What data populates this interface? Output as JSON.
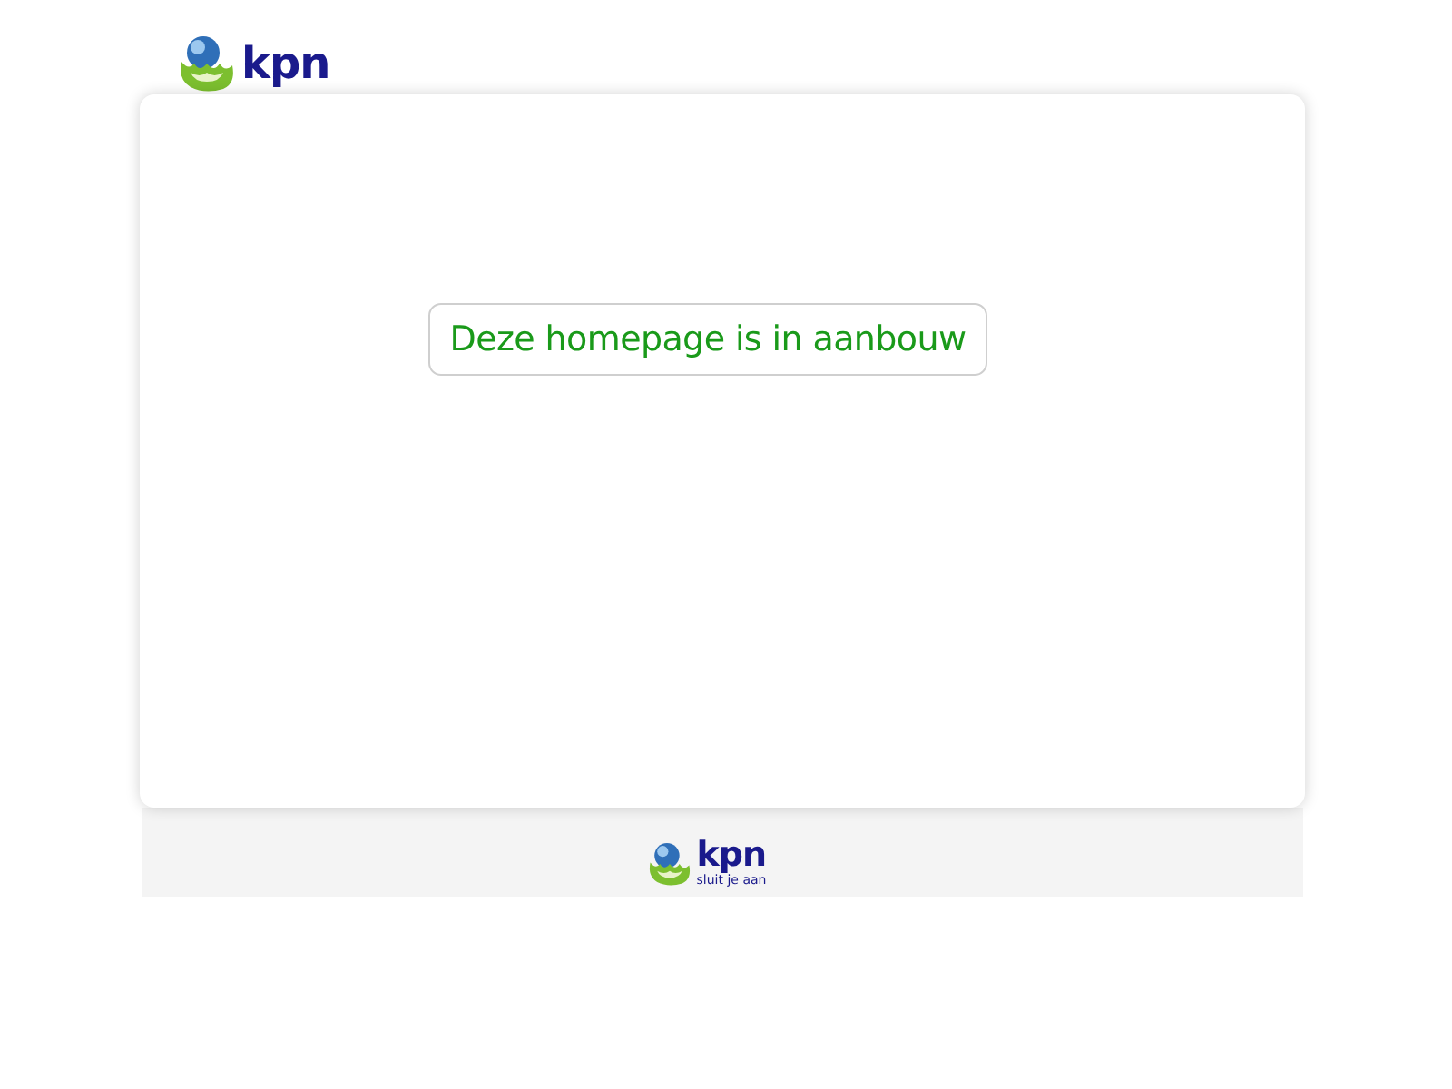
{
  "header": {
    "logo_text": "kpn"
  },
  "message": "Deze homepage is in aanbouw",
  "footer": {
    "logo_text": "kpn",
    "tagline": "sluit je aan"
  }
}
